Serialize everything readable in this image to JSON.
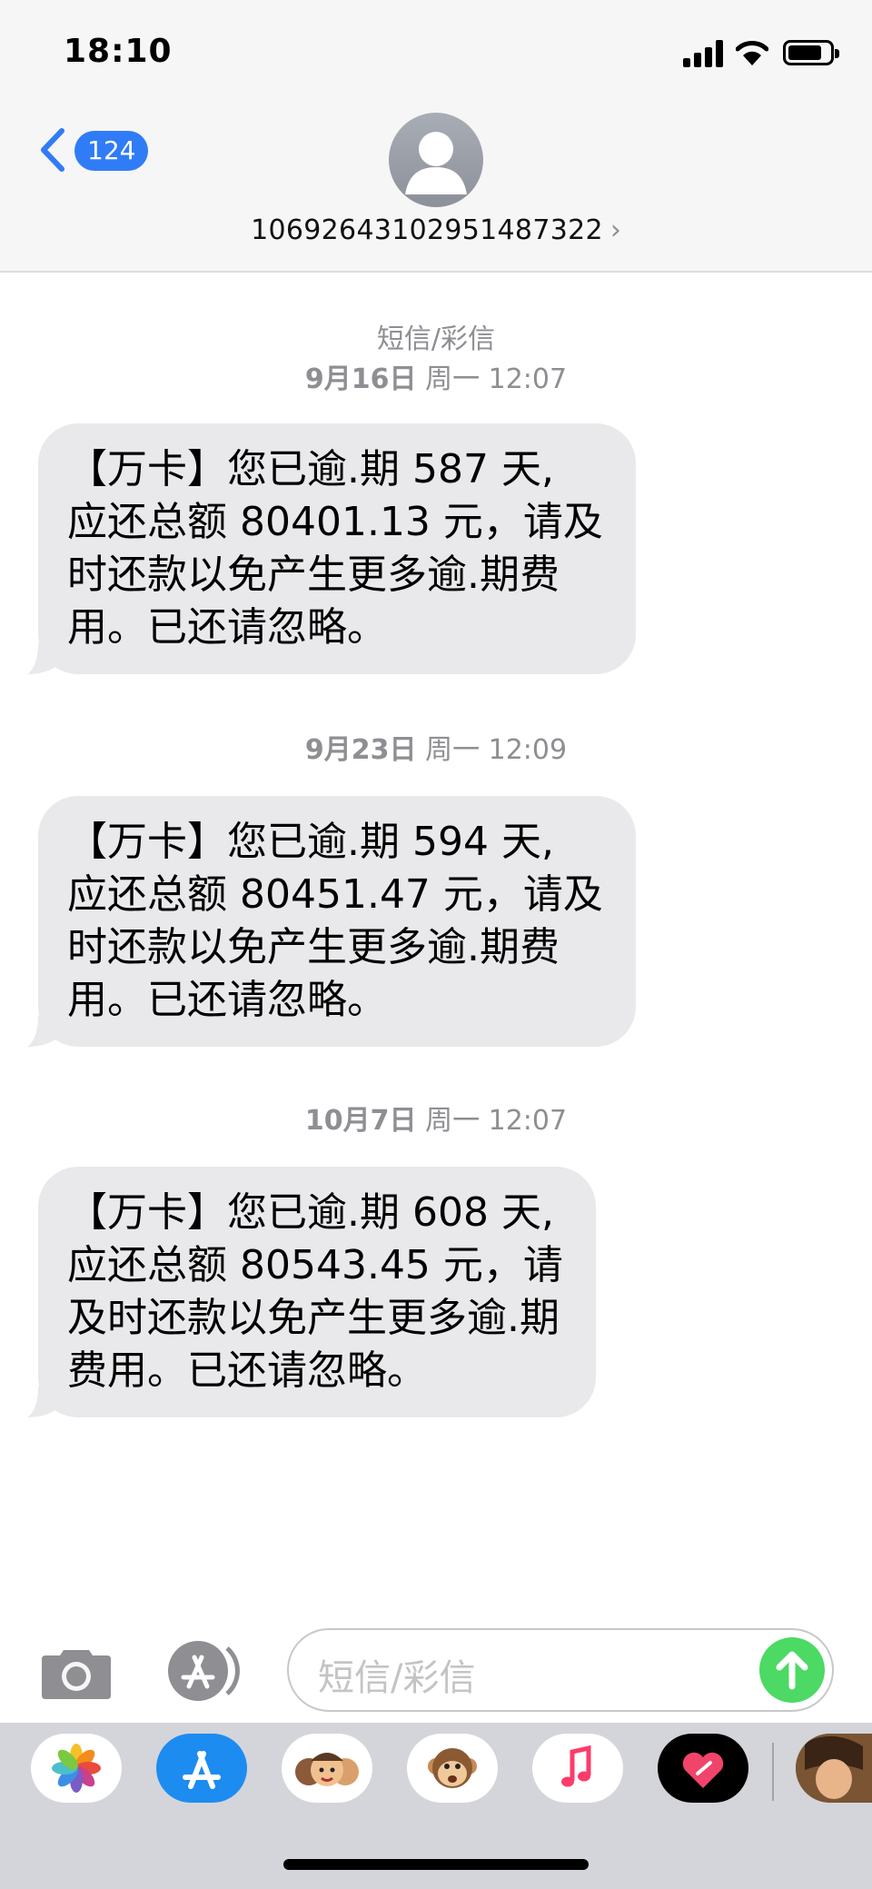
{
  "status_bar": {
    "time": "18:10"
  },
  "header": {
    "back_badge": "124",
    "contact_number": "1069264310295148732",
    "contact_number_tail": "2"
  },
  "conversation": {
    "type_label": "短信/彩信",
    "messages": [
      {
        "date": "9月16日",
        "weekday_time": "周一 12:07",
        "lines": [
          "【万卡】您已逾.期 587 天,",
          "应还总额 80401.13 元，请及",
          "时还款以免产生更多逾.期费",
          "用。已还请忽略。"
        ]
      },
      {
        "date": "9月23日",
        "weekday_time": "周一 12:09",
        "lines": [
          "【万卡】您已逾.期 594 天,",
          "应还总额 80451.47 元，请及",
          "时还款以免产生更多逾.期费",
          "用。已还请忽略。"
        ]
      },
      {
        "date": "10月7日",
        "weekday_time": "周一 12:07",
        "lines": [
          "【万卡】您已逾.期 608 天,",
          "应还总额 80543.45 元，请",
          "及时还款以免产生更多逾.期",
          "费用。已还请忽略。"
        ]
      }
    ]
  },
  "composer": {
    "placeholder": "短信/彩信",
    "send_color": "#4cd964"
  },
  "app_drawer": {
    "apps": [
      "photos-icon",
      "app-store-icon",
      "memoji-icon",
      "animoji-icon",
      "music-icon",
      "digital-touch-icon",
      "game-icon"
    ]
  },
  "colors": {
    "accent": "#2f7cf6",
    "bubble": "#e9e9eb",
    "meta": "#8e8e93"
  }
}
